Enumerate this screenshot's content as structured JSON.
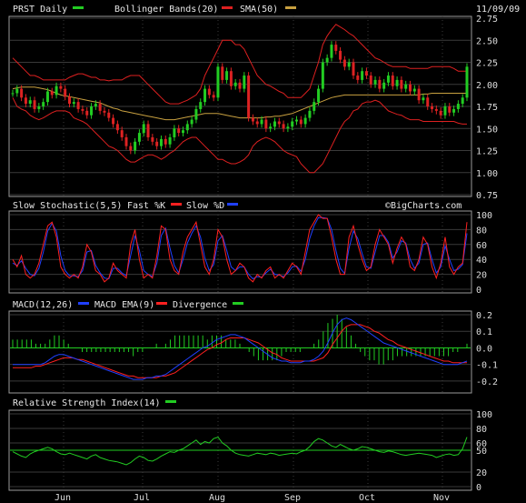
{
  "colors": {
    "background": "#000000",
    "panel_border": "#9a9a9a",
    "grid": "#3a3a3a",
    "price_up": "#22cc22",
    "price_down": "#dd2222",
    "bollinger": "#dd2020",
    "sma": "#c8a040",
    "fast_k": "#ff2020",
    "slow_d": "#2040ff",
    "macd": "#2040ff",
    "macd_ema": "#ff2020",
    "divergence": "#22cc22",
    "rsi": "#22cc22",
    "rsi_ref": "#22cc22"
  },
  "header": {
    "symbol_label": "PRST Daily",
    "bollinger_label": "Bollinger Bands(20)",
    "sma_label": "SMA(50)",
    "date": "11/09/09"
  },
  "watermark": "©BigCharts.com",
  "x_axis_months": [
    "Jun",
    "Jul",
    "Aug",
    "Sep",
    "Oct",
    "Nov"
  ],
  "chart_data": [
    {
      "type": "candlestick",
      "title": "PRST Daily",
      "legend": [
        "Bollinger Bands(20)",
        "SMA(50)"
      ],
      "y_ticks": [
        "2.75",
        "2.50",
        "2.25",
        "2.00",
        "1.75",
        "1.50",
        "1.25",
        "1.00",
        "0.75"
      ],
      "ylim": [
        0.75,
        2.75
      ],
      "closes": [
        1.9,
        1.95,
        1.85,
        1.78,
        1.82,
        1.72,
        1.75,
        1.8,
        1.92,
        1.88,
        1.98,
        1.95,
        1.86,
        1.78,
        1.8,
        1.72,
        1.7,
        1.65,
        1.75,
        1.78,
        1.7,
        1.68,
        1.62,
        1.55,
        1.48,
        1.4,
        1.3,
        1.25,
        1.35,
        1.45,
        1.55,
        1.4,
        1.35,
        1.3,
        1.38,
        1.32,
        1.4,
        1.5,
        1.45,
        1.48,
        1.55,
        1.6,
        1.72,
        1.8,
        1.95,
        1.88,
        1.85,
        2.2,
        2.05,
        2.15,
        1.98,
        2.02,
        1.95,
        2.1,
        1.62,
        1.58,
        1.55,
        1.6,
        1.5,
        1.52,
        1.58,
        1.55,
        1.5,
        1.52,
        1.58,
        1.6,
        1.55,
        1.62,
        1.7,
        1.8,
        1.95,
        2.25,
        2.3,
        2.45,
        2.38,
        2.28,
        2.2,
        2.25,
        2.1,
        2.05,
        2.15,
        2.1,
        2.0,
        2.05,
        1.95,
        2.02,
        2.1,
        1.98,
        2.05,
        1.95,
        2.0,
        1.92,
        1.95,
        1.82,
        1.85,
        1.75,
        1.72,
        1.7,
        1.65,
        1.75,
        1.68,
        1.72,
        1.78,
        1.85,
        2.2
      ],
      "bollinger_upper": [
        2.3,
        2.25,
        2.2,
        2.15,
        2.1,
        2.1,
        2.08,
        2.05,
        2.05,
        2.05,
        2.05,
        2.05,
        2.05,
        2.08,
        2.1,
        2.12,
        2.12,
        2.1,
        2.08,
        2.08,
        2.05,
        2.05,
        2.04,
        2.05,
        2.05,
        2.05,
        2.08,
        2.1,
        2.1,
        2.1,
        2.05,
        2.0,
        1.95,
        1.9,
        1.85,
        1.8,
        1.78,
        1.78,
        1.78,
        1.8,
        1.82,
        1.85,
        1.88,
        1.95,
        2.1,
        2.2,
        2.3,
        2.4,
        2.5,
        2.5,
        2.5,
        2.45,
        2.45,
        2.4,
        2.3,
        2.2,
        2.1,
        2.05,
        2.0,
        1.98,
        1.95,
        1.92,
        1.9,
        1.85,
        1.85,
        1.85,
        1.85,
        1.9,
        1.95,
        2.1,
        2.25,
        2.45,
        2.55,
        2.62,
        2.68,
        2.65,
        2.62,
        2.58,
        2.55,
        2.5,
        2.45,
        2.4,
        2.35,
        2.3,
        2.28,
        2.25,
        2.22,
        2.2,
        2.2,
        2.2,
        2.2,
        2.18,
        2.18,
        2.18,
        2.18,
        2.18,
        2.2,
        2.2,
        2.2,
        2.2,
        2.2,
        2.18,
        2.15,
        2.15,
        2.15
      ],
      "bollinger_lower": [
        1.85,
        1.75,
        1.72,
        1.7,
        1.65,
        1.62,
        1.6,
        1.62,
        1.65,
        1.68,
        1.7,
        1.7,
        1.7,
        1.68,
        1.62,
        1.6,
        1.58,
        1.55,
        1.5,
        1.45,
        1.4,
        1.35,
        1.3,
        1.28,
        1.25,
        1.2,
        1.15,
        1.12,
        1.12,
        1.15,
        1.18,
        1.2,
        1.2,
        1.18,
        1.15,
        1.18,
        1.22,
        1.25,
        1.3,
        1.35,
        1.38,
        1.4,
        1.4,
        1.35,
        1.3,
        1.25,
        1.2,
        1.15,
        1.15,
        1.12,
        1.1,
        1.1,
        1.12,
        1.15,
        1.2,
        1.3,
        1.35,
        1.38,
        1.4,
        1.38,
        1.35,
        1.3,
        1.25,
        1.22,
        1.2,
        1.18,
        1.1,
        1.05,
        1.0,
        1.0,
        1.05,
        1.1,
        1.2,
        1.3,
        1.4,
        1.5,
        1.58,
        1.62,
        1.7,
        1.72,
        1.78,
        1.8,
        1.8,
        1.82,
        1.8,
        1.75,
        1.7,
        1.68,
        1.66,
        1.65,
        1.62,
        1.6,
        1.6,
        1.6,
        1.58,
        1.58,
        1.58,
        1.58,
        1.58,
        1.58,
        1.58,
        1.58,
        1.56,
        1.55,
        1.55
      ],
      "sma50": [
        1.95,
        1.96,
        1.97,
        1.97,
        1.97,
        1.97,
        1.96,
        1.95,
        1.94,
        1.92,
        1.9,
        1.88,
        1.87,
        1.86,
        1.85,
        1.84,
        1.83,
        1.82,
        1.81,
        1.8,
        1.79,
        1.77,
        1.75,
        1.73,
        1.72,
        1.7,
        1.69,
        1.68,
        1.67,
        1.66,
        1.65,
        1.64,
        1.63,
        1.62,
        1.61,
        1.6,
        1.6,
        1.6,
        1.61,
        1.62,
        1.63,
        1.64,
        1.65,
        1.66,
        1.67,
        1.67,
        1.67,
        1.67,
        1.66,
        1.65,
        1.64,
        1.63,
        1.62,
        1.62,
        1.62,
        1.62,
        1.62,
        1.62,
        1.63,
        1.63,
        1.64,
        1.64,
        1.65,
        1.66,
        1.67,
        1.69,
        1.71,
        1.73,
        1.75,
        1.77,
        1.79,
        1.81,
        1.83,
        1.85,
        1.86,
        1.87,
        1.88,
        1.88,
        1.88,
        1.88,
        1.88,
        1.88,
        1.88,
        1.88,
        1.88,
        1.88,
        1.88,
        1.88,
        1.88,
        1.88,
        1.88,
        1.88,
        1.88,
        1.88,
        1.89,
        1.89,
        1.9,
        1.9,
        1.9,
        1.9,
        1.9,
        1.9,
        1.9,
        1.9,
        1.9
      ]
    },
    {
      "type": "line",
      "title": "Slow Stochastic(5,5)",
      "legend": [
        "Fast %K",
        "Slow %D"
      ],
      "y_ticks": [
        "100",
        "80",
        "60",
        "40",
        "20",
        "0"
      ],
      "ylim": [
        0,
        100
      ],
      "series": [
        {
          "name": "Fast %K",
          "values": [
            40,
            30,
            45,
            20,
            15,
            20,
            35,
            60,
            85,
            90,
            70,
            30,
            20,
            15,
            20,
            15,
            30,
            60,
            50,
            25,
            20,
            10,
            15,
            35,
            25,
            20,
            15,
            60,
            80,
            40,
            15,
            20,
            15,
            45,
            85,
            80,
            40,
            25,
            20,
            50,
            70,
            80,
            90,
            60,
            30,
            20,
            40,
            80,
            70,
            40,
            20,
            25,
            35,
            30,
            15,
            10,
            20,
            15,
            25,
            30,
            15,
            20,
            15,
            25,
            35,
            30,
            20,
            50,
            80,
            90,
            100,
            95,
            95,
            70,
            40,
            20,
            20,
            70,
            85,
            60,
            40,
            25,
            30,
            60,
            80,
            70,
            60,
            35,
            55,
            70,
            60,
            30,
            25,
            40,
            70,
            60,
            30,
            15,
            35,
            70,
            30,
            20,
            30,
            35,
            90
          ]
        },
        {
          "name": "Slow %D",
          "values": [
            35,
            32,
            38,
            28,
            20,
            18,
            28,
            50,
            78,
            88,
            78,
            45,
            25,
            18,
            18,
            17,
            25,
            50,
            52,
            32,
            22,
            15,
            14,
            28,
            28,
            22,
            18,
            45,
            72,
            52,
            25,
            20,
            17,
            35,
            72,
            82,
            55,
            32,
            22,
            40,
            62,
            75,
            85,
            70,
            42,
            25,
            33,
            65,
            72,
            52,
            30,
            25,
            30,
            30,
            20,
            14,
            17,
            16,
            22,
            27,
            20,
            19,
            17,
            22,
            30,
            31,
            24,
            40,
            68,
            85,
            96,
            96,
            95,
            80,
            52,
            28,
            21,
            55,
            78,
            68,
            48,
            30,
            28,
            50,
            72,
            72,
            63,
            42,
            50,
            65,
            62,
            40,
            28,
            35,
            60,
            62,
            40,
            22,
            30,
            58,
            40,
            25,
            27,
            33,
            75
          ]
        }
      ]
    },
    {
      "type": "line",
      "title": "MACD(12,26)",
      "legend": [
        "MACD EMA(9)",
        "Divergence"
      ],
      "y_ticks": [
        "0.2",
        "0.1",
        "0.0",
        "-0.1",
        "-0.2"
      ],
      "ylim": [
        -0.25,
        0.2
      ],
      "series": [
        {
          "name": "MACD",
          "values": [
            -0.1,
            -0.1,
            -0.1,
            -0.1,
            -0.1,
            -0.1,
            -0.1,
            -0.09,
            -0.07,
            -0.05,
            -0.04,
            -0.04,
            -0.05,
            -0.06,
            -0.07,
            -0.08,
            -0.09,
            -0.1,
            -0.11,
            -0.12,
            -0.13,
            -0.14,
            -0.15,
            -0.16,
            -0.17,
            -0.18,
            -0.19,
            -0.19,
            -0.19,
            -0.18,
            -0.18,
            -0.17,
            -0.17,
            -0.16,
            -0.14,
            -0.12,
            -0.1,
            -0.08,
            -0.06,
            -0.04,
            -0.02,
            0.0,
            0.01,
            0.03,
            0.05,
            0.06,
            0.07,
            0.08,
            0.08,
            0.07,
            0.06,
            0.04,
            0.02,
            0.0,
            -0.02,
            -0.04,
            -0.06,
            -0.07,
            -0.08,
            -0.08,
            -0.09,
            -0.09,
            -0.09,
            -0.08,
            -0.08,
            -0.07,
            -0.05,
            -0.02,
            0.03,
            0.09,
            0.14,
            0.17,
            0.18,
            0.17,
            0.15,
            0.13,
            0.11,
            0.09,
            0.07,
            0.05,
            0.03,
            0.02,
            0.01,
            0.0,
            -0.01,
            -0.02,
            -0.03,
            -0.04,
            -0.05,
            -0.06,
            -0.07,
            -0.08,
            -0.09,
            -0.1,
            -0.1,
            -0.1,
            -0.1,
            -0.09,
            -0.08
          ]
        },
        {
          "name": "MACD EMA(9)",
          "values": [
            -0.12,
            -0.12,
            -0.12,
            -0.12,
            -0.12,
            -0.11,
            -0.11,
            -0.1,
            -0.09,
            -0.08,
            -0.07,
            -0.06,
            -0.06,
            -0.06,
            -0.07,
            -0.07,
            -0.08,
            -0.09,
            -0.1,
            -0.11,
            -0.12,
            -0.13,
            -0.14,
            -0.15,
            -0.16,
            -0.17,
            -0.17,
            -0.18,
            -0.18,
            -0.18,
            -0.18,
            -0.18,
            -0.17,
            -0.17,
            -0.16,
            -0.15,
            -0.13,
            -0.11,
            -0.09,
            -0.07,
            -0.05,
            -0.03,
            -0.01,
            0.0,
            0.02,
            0.03,
            0.05,
            0.06,
            0.06,
            0.06,
            0.06,
            0.05,
            0.04,
            0.03,
            0.01,
            -0.01,
            -0.03,
            -0.04,
            -0.06,
            -0.07,
            -0.08,
            -0.08,
            -0.08,
            -0.08,
            -0.08,
            -0.08,
            -0.07,
            -0.06,
            -0.03,
            0.02,
            0.06,
            0.1,
            0.13,
            0.14,
            0.14,
            0.14,
            0.13,
            0.12,
            0.1,
            0.09,
            0.07,
            0.05,
            0.04,
            0.02,
            0.01,
            0.0,
            -0.01,
            -0.02,
            -0.03,
            -0.04,
            -0.05,
            -0.06,
            -0.07,
            -0.08,
            -0.08,
            -0.09,
            -0.09,
            -0.09,
            -0.09
          ]
        }
      ]
    },
    {
      "type": "line",
      "title": "Relative Strength Index(14)",
      "y_ticks": [
        "100",
        "80",
        "60",
        "50",
        "20",
        "0"
      ],
      "ylim": [
        0,
        100
      ],
      "reference_line": 50,
      "series": [
        {
          "name": "RSI",
          "values": [
            48,
            45,
            42,
            40,
            45,
            48,
            50,
            52,
            54,
            52,
            48,
            45,
            44,
            46,
            44,
            42,
            40,
            38,
            42,
            44,
            40,
            38,
            36,
            35,
            34,
            32,
            30,
            33,
            38,
            42,
            40,
            36,
            35,
            38,
            42,
            45,
            48,
            47,
            50,
            52,
            56,
            60,
            64,
            58,
            62,
            60,
            66,
            68,
            60,
            56,
            50,
            46,
            44,
            43,
            42,
            44,
            46,
            45,
            44,
            46,
            45,
            43,
            44,
            45,
            46,
            45,
            48,
            50,
            55,
            62,
            66,
            64,
            60,
            56,
            54,
            58,
            55,
            52,
            50,
            52,
            55,
            54,
            52,
            50,
            48,
            47,
            49,
            48,
            46,
            44,
            43,
            44,
            45,
            46,
            45,
            44,
            43,
            40,
            42,
            44,
            45,
            43,
            44,
            52,
            68
          ]
        }
      ]
    }
  ]
}
